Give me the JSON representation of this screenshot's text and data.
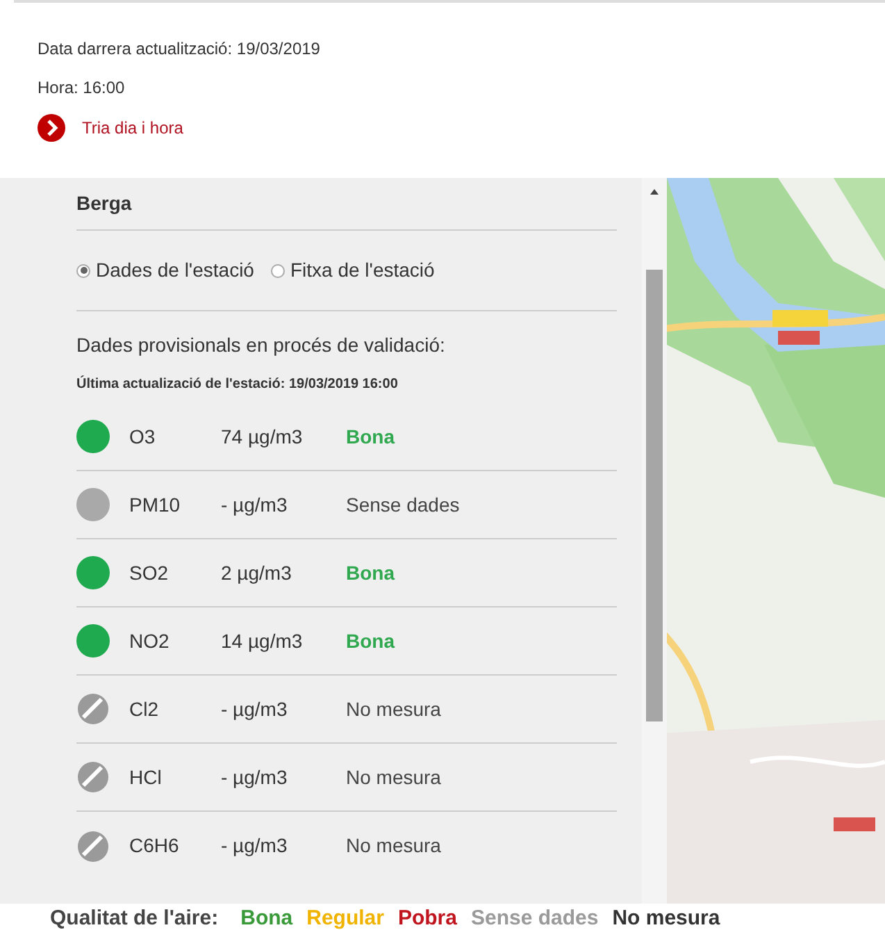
{
  "header": {
    "last_update": "Data darrera actualització: 19/03/2019",
    "time": "Hora: 16:00",
    "link": "Tria dia i hora"
  },
  "station": {
    "name": "Berga",
    "views": [
      {
        "label": "Dades de l'estació",
        "selected": true
      },
      {
        "label": "Fitxa de l'estació",
        "selected": false
      }
    ],
    "notice": "Dades provisionals en procés de validació:",
    "station_update": "Última actualizació de l'estació: 19/03/2019 16:00",
    "pollutants": [
      {
        "kind": "dot",
        "color": "#1faa4f",
        "name": "O3",
        "value": "74 µg/m3",
        "status": {
          "text": "Bona",
          "color": "#2fa84f"
        }
      },
      {
        "kind": "dot",
        "color": "#a9a9a9",
        "name": "PM10",
        "value": "- µg/m3",
        "status": {
          "text": "Sense dades",
          "color": "#444444"
        }
      },
      {
        "kind": "dot",
        "color": "#1faa4f",
        "name": "SO2",
        "value": "2 µg/m3",
        "status": {
          "text": "Bona",
          "color": "#2fa84f"
        }
      },
      {
        "kind": "dot",
        "color": "#1faa4f",
        "name": "NO2",
        "value": "14 µg/m3",
        "status": {
          "text": "Bona",
          "color": "#2fa84f"
        }
      },
      {
        "kind": "hatched",
        "name": "Cl2",
        "value": "- µg/m3",
        "status": {
          "text": "No mesura",
          "color": "#444444"
        }
      },
      {
        "kind": "hatched",
        "name": "HCl",
        "value": "- µg/m3",
        "status": {
          "text": "No mesura",
          "color": "#444444"
        }
      },
      {
        "kind": "hatched",
        "name": "C6H6",
        "value": "- µg/m3",
        "status": {
          "text": "No mesura",
          "color": "#444444"
        }
      }
    ]
  },
  "legend": {
    "title": "Qualitat de l'aire:",
    "items": [
      {
        "label": "Bona",
        "color": "#3a9a3a"
      },
      {
        "label": "Regular",
        "color": "#f0b400"
      },
      {
        "label": "Pobra",
        "color": "#c0141e"
      },
      {
        "label": "Sense dades",
        "color": "#9a9a9a"
      },
      {
        "label": "No mesura",
        "color": "#333333"
      }
    ]
  }
}
